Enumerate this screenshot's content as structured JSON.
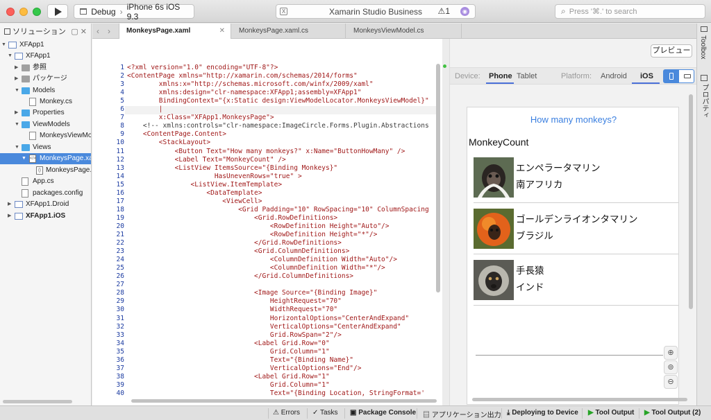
{
  "toolbar": {
    "config": "Debug",
    "device": "iPhone 6s iOS 9.3",
    "status_title": "Xamarin Studio Business",
    "warning_count": "1",
    "search_placeholder": "Press '⌘.' to search"
  },
  "solution_pad": {
    "title": "ソリューション",
    "items": [
      {
        "label": "XFApp1"
      },
      {
        "label": "XFApp1"
      },
      {
        "label": "参照"
      },
      {
        "label": "パッケージ"
      },
      {
        "label": "Models"
      },
      {
        "label": "Monkey.cs"
      },
      {
        "label": "Properties"
      },
      {
        "label": "ViewModels"
      },
      {
        "label": "MonkeysViewModel.cs"
      },
      {
        "label": "Views"
      },
      {
        "label": "MonkeysPage.xaml"
      },
      {
        "label": "MonkeysPage.xaml.cs"
      },
      {
        "label": "App.cs"
      },
      {
        "label": "packages.config"
      },
      {
        "label": "XFApp1.Droid"
      },
      {
        "label": "XFApp1.iOS"
      }
    ]
  },
  "tabs": [
    {
      "label": "MonkeysPage.xaml"
    },
    {
      "label": "MonkeysPage.xaml.cs"
    },
    {
      "label": "MonkeysViewModel.cs"
    }
  ],
  "editor": {
    "lines": [
      "<?xml version=\"1.0\" encoding=\"UTF-8\"?>",
      "<ContentPage xmlns=\"http://xamarin.com/schemas/2014/forms\"",
      "        xmlns:x=\"http://schemas.microsoft.com/winfx/2009/xaml\"",
      "        xmlns:design=\"clr-namespace:XFApp1;assembly=XFApp1\"",
      "        BindingContext=\"{x:Static design:ViewModelLocator.MonkeysViewModel}\"",
      "        |",
      "        x:Class=\"XFApp1.MonkeysPage\">",
      "    <!-- xmlns:controls=\"clr-namespace:ImageCircle.Forms.Plugin.Abstractions",
      "    <ContentPage.Content>",
      "        <StackLayout>",
      "            <Button Text=\"How many monkeys?\" x:Name=\"ButtonHowMany\" />",
      "            <Label Text=\"MonkeyCount\" />",
      "            <ListView ItemsSource=\"{Binding Monkeys}\"",
      "                      HasUnevenRows=\"true\" >",
      "                <ListView.ItemTemplate>",
      "                    <DataTemplate>",
      "                        <ViewCell>",
      "                            <Grid Padding=\"10\" RowSpacing=\"10\" ColumnSpacing",
      "                                <Grid.RowDefinitions>",
      "                                    <RowDefinition Height=\"Auto\"/>",
      "                                    <RowDefinition Height=\"*\"/>",
      "                                </Grid.RowDefinitions>",
      "                                <Grid.ColumnDefinitions>",
      "                                    <ColumnDefinition Width=\"Auto\"/>",
      "                                    <ColumnDefinition Width=\"*\"/>",
      "                                </Grid.ColumnDefinitions>",
      "",
      "                                <Image Source=\"{Binding Image}\"",
      "                                    HeightRequest=\"70\"",
      "                                    WidthRequest=\"70\"",
      "                                    HorizontalOptions=\"CenterAndExpand\"",
      "                                    VerticalOptions=\"CenterAndExpand\"",
      "                                    Grid.RowSpan=\"2\"/>",
      "                                <Label Grid.Row=\"0\"",
      "                                    Grid.Column=\"1\"",
      "                                    Text=\"{Binding Name}\"",
      "                                    VerticalOptions=\"End\"/>",
      "                                <Label Grid.Row=\"1\"",
      "                                    Grid.Column=\"1\"",
      "                                    Text=\"{Binding Location, StringFormat='"
    ]
  },
  "preview": {
    "button": "プレビュー",
    "device_label": "Device:",
    "device_options": [
      "Phone",
      "Tablet"
    ],
    "platform_label": "Platform:",
    "platform_options": [
      "Android",
      "iOS"
    ],
    "app": {
      "button_text": "How many monkeys?",
      "count_label": "MonkeyCount",
      "monkeys": [
        {
          "name": "エンペラータマリン",
          "location": "南アフリカ"
        },
        {
          "name": "ゴールデンライオンタマリン",
          "location": "ブラジル"
        },
        {
          "name": "手長猿",
          "location": "インド"
        }
      ]
    }
  },
  "right_strip": {
    "toolbox": "Toolbox",
    "properties": "プロパティ"
  },
  "status_bar": {
    "errors": "Errors",
    "tasks": "Tasks",
    "package_console": "Package Console",
    "app_output": "アプリケーション出力",
    "deploying": "Deploying to Device",
    "tool_output": "Tool Output",
    "tool_output_2": "Tool Output (2)"
  }
}
